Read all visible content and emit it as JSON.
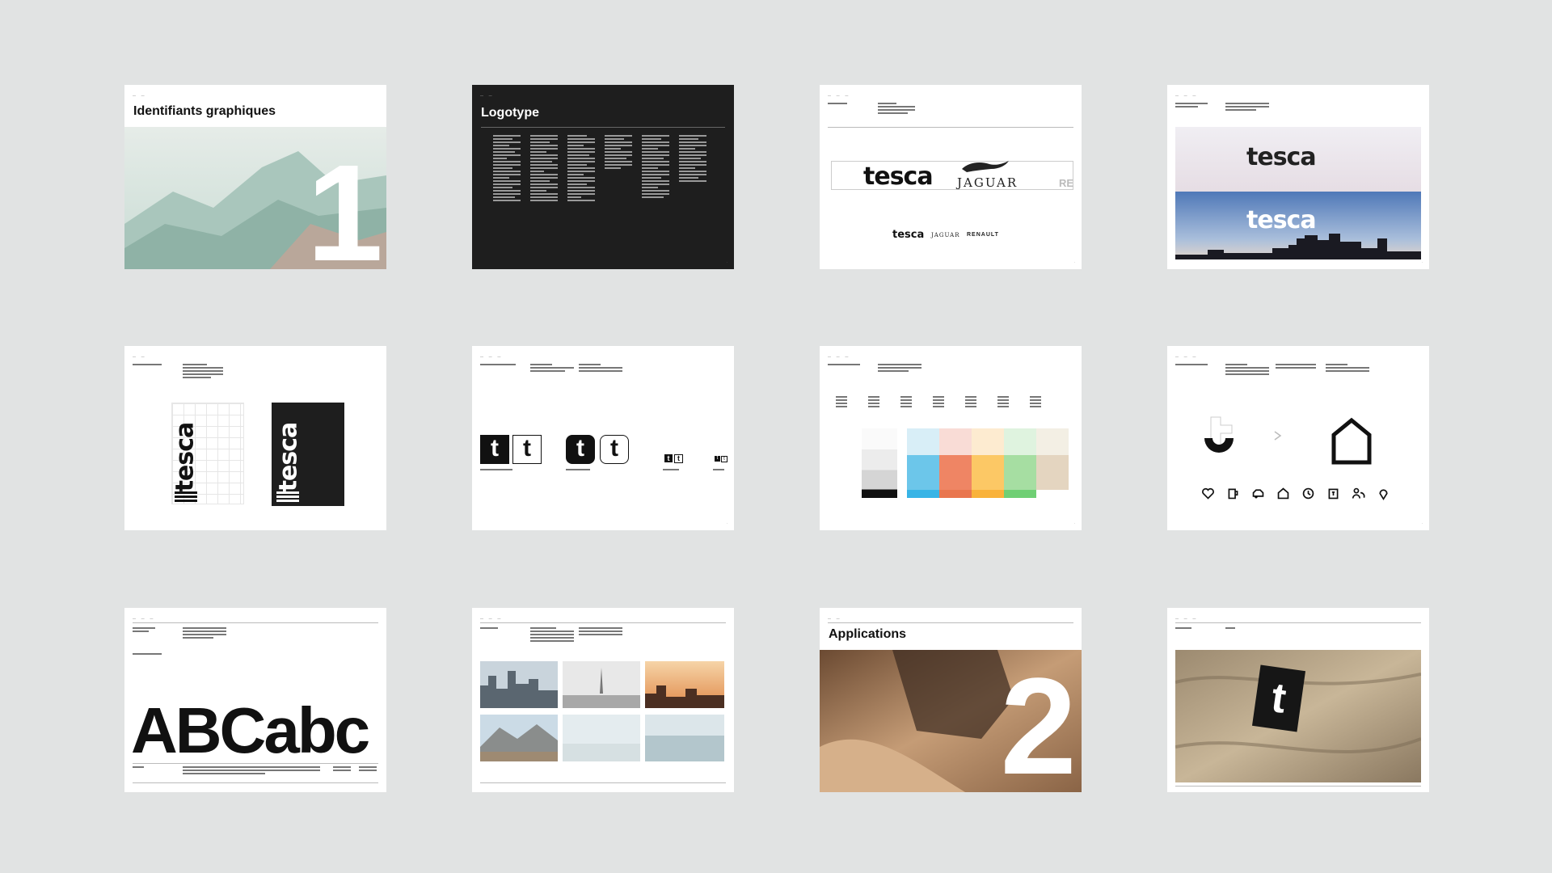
{
  "slides": {
    "s1": {
      "title": "Identifiants graphiques",
      "number": "1"
    },
    "s2": {
      "title": "Logotype"
    },
    "s3": {
      "wordmark": "tesca",
      "partner1": "JAGUAR",
      "partner2": "RENAULT",
      "partner_cut": "RE"
    },
    "s4": {
      "wordmark": "tesca"
    },
    "s5": {
      "wordmark": "tesca"
    },
    "s6": {
      "mark": "t"
    },
    "s9": {
      "specimen": "ABCabc"
    },
    "s11": {
      "title": "Applications",
      "number": "2"
    },
    "s12": {
      "mark": "t"
    }
  },
  "colors": {
    "background": "#e1e3e3",
    "dark_slide": "#1e1e1e",
    "palette_light": [
      "#d8eef7",
      "#f9dcd6",
      "#fdebd0",
      "#dff3df",
      "#f3efe4"
    ],
    "palette_mid": [
      "#6cc6ea",
      "#ef8564",
      "#fcc865",
      "#a6dea2",
      "#e4d5c0"
    ],
    "palette_strip": [
      "#38b4e6",
      "#e9764f",
      "#f9b23a",
      "#6fcf74"
    ]
  },
  "icons": [
    "heart-icon",
    "mug-icon",
    "car-icon",
    "house-icon",
    "clock-icon",
    "luggage-icon",
    "people-icon",
    "location-pin-icon"
  ]
}
